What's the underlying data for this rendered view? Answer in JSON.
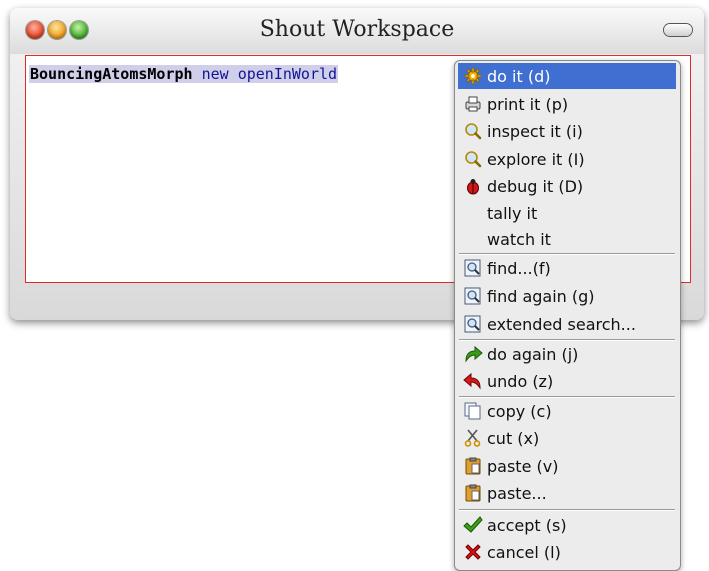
{
  "window": {
    "title": "Shout Workspace"
  },
  "editor": {
    "class_name": "BouncingAtomsMorph",
    "keyword_new": "new",
    "message": "openInWorld",
    "space": " "
  },
  "menu": {
    "items": [
      {
        "label": "do it (d)",
        "icon": "gear-icon",
        "selected": true
      },
      {
        "label": "print it (p)",
        "icon": "printer-icon"
      },
      {
        "label": "inspect it (i)",
        "icon": "magnifier-icon"
      },
      {
        "label": "explore it (I)",
        "icon": "magnifier-icon"
      },
      {
        "label": "debug it (D)",
        "icon": "bug-icon"
      },
      {
        "label": "tally it",
        "icon": ""
      },
      {
        "label": "watch it",
        "icon": ""
      },
      {
        "label": "find...(f)",
        "icon": "find-icon"
      },
      {
        "label": "find again (g)",
        "icon": "find-icon"
      },
      {
        "label": "extended search...",
        "icon": "find-icon"
      },
      {
        "label": "do again (j)",
        "icon": "redo-icon"
      },
      {
        "label": "undo (z)",
        "icon": "undo-icon"
      },
      {
        "label": "copy (c)",
        "icon": "copy-icon"
      },
      {
        "label": "cut (x)",
        "icon": "scissors-icon"
      },
      {
        "label": "paste (v)",
        "icon": "paste-icon"
      },
      {
        "label": "paste...",
        "icon": "paste-icon"
      },
      {
        "label": "accept (s)",
        "icon": "checkmark-icon"
      },
      {
        "label": "cancel (l)",
        "icon": "cross-icon"
      }
    ]
  },
  "colors": {
    "selection": "#3f6fd0",
    "editor_border": "#e22a2a",
    "code_highlight": "#cfcfea"
  }
}
